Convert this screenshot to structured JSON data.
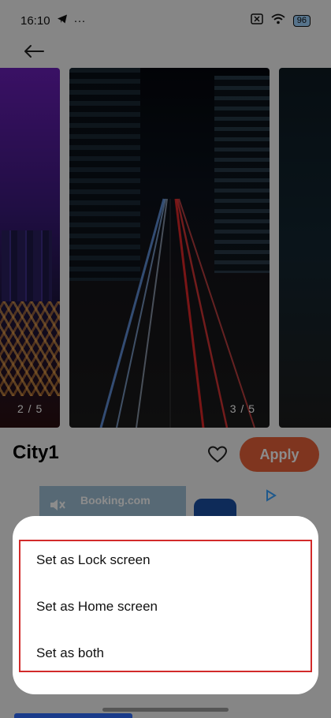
{
  "status": {
    "time": "16:10",
    "battery": "96"
  },
  "wallpaper": {
    "title": "City1",
    "left_indicator": "2 / 5",
    "main_indicator": "3 / 5",
    "apply_label": "Apply"
  },
  "ad": {
    "brand_text": "Booking.com"
  },
  "sheet": {
    "options": [
      "Set as Lock screen",
      "Set as Home screen",
      "Set as both"
    ]
  },
  "colors": {
    "accent": "#e8623a",
    "highlight_border": "#d22a2a"
  }
}
